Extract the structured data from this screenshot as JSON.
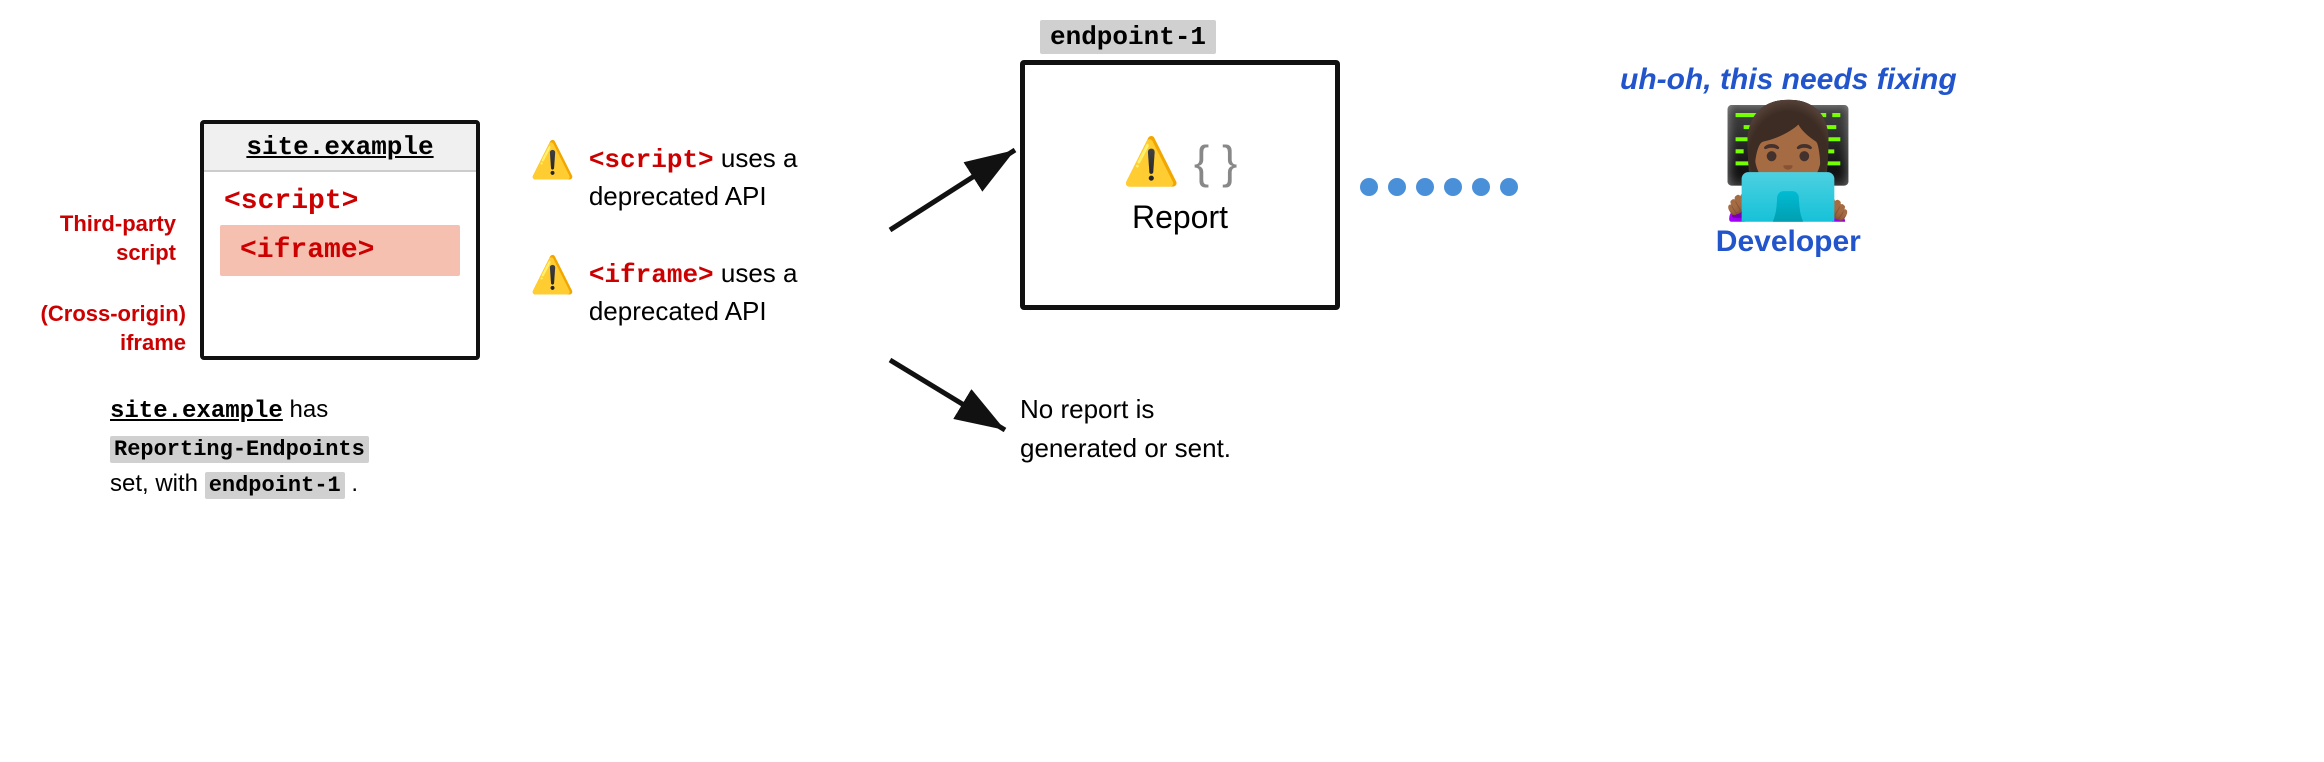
{
  "site_box": {
    "title": "site.example",
    "script_tag": "<script>",
    "iframe_tag": "<iframe>"
  },
  "labels": {
    "third_party": "Third-party\nscript",
    "cross_origin": "(Cross-origin)\niframe"
  },
  "bottom_caption": {
    "line1_mono": "site.example",
    "line1_text": " has",
    "line2_mono_bg": "Reporting-Endpoints",
    "line3_text": "set, with",
    "line3_mono_bg": "endpoint-1",
    "line3_end": " ."
  },
  "warnings": [
    {
      "icon": "⚠️",
      "text_red": "<script>",
      "text_rest": " uses a\ndeprecated API"
    },
    {
      "icon": "⚠️",
      "text_red": "<iframe>",
      "text_rest": " uses a\ndeprecated API"
    }
  ],
  "endpoint": {
    "label": "endpoint-1",
    "warning_icon": "⚠️",
    "curly": "{ }",
    "report_label": "Report"
  },
  "no_report": "No report is\ngenerated or sent.",
  "dotted_dots": 6,
  "developer": {
    "uh_oh": "uh-oh,\nthis\nneeds\nfixing",
    "emoji": "👩🏾‍💻",
    "label": "Developer"
  }
}
